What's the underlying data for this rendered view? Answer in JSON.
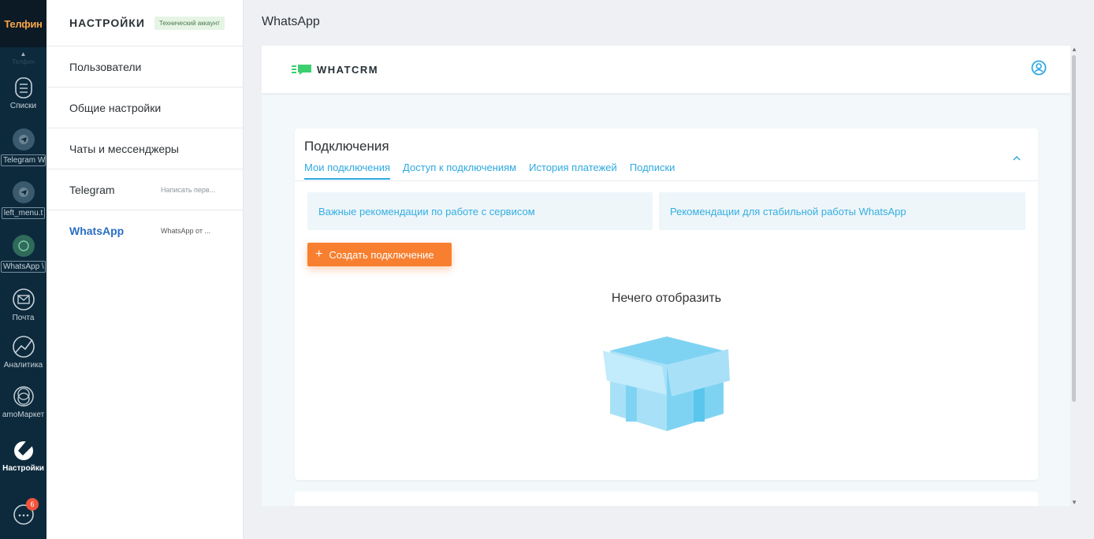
{
  "app": {
    "logo": "Телфин"
  },
  "left_nav": {
    "scroll_hint": "Телфин",
    "items": [
      {
        "label": "Списки",
        "icon": "list-icon"
      },
      {
        "label": "Telegram W",
        "icon": "telegram-icon"
      },
      {
        "label": "left_menu.t",
        "icon": "telegram-icon"
      },
      {
        "label": "WhatsApp \\",
        "icon": "whatsapp-icon"
      },
      {
        "label": "Почта",
        "icon": "mail-icon"
      },
      {
        "label": "Аналитика",
        "icon": "analytics-icon"
      },
      {
        "label": "amoМаркет",
        "icon": "market-icon"
      },
      {
        "label": "Настройки",
        "icon": "settings-icon"
      }
    ],
    "chat_badge": "6"
  },
  "settings": {
    "title": "НАСТРОЙКИ",
    "account_badge": "Технический аккаунт",
    "items": [
      {
        "label": "Пользователи"
      },
      {
        "label": "Общие настройки"
      },
      {
        "label": "Чаты и мессенджеры"
      },
      {
        "label": "Telegram",
        "sub": "Написать перв..."
      },
      {
        "label": "WhatsApp",
        "sub": "WhatsApp от ..."
      }
    ]
  },
  "main": {
    "page_title": "WhatsApp",
    "brand": "WHATCRM",
    "card": {
      "title": "Подключения",
      "tabs": [
        "Мои подключения",
        "Доступ к подключениям",
        "История платежей",
        "Подписки"
      ],
      "active_tab": 0,
      "recommendations": [
        "Важные рекомендации по работе с сервисом",
        "Рекомендации для стабильной работы WhatsApp"
      ],
      "create_button": "Создать подключение",
      "empty_text": "Нечего отобразить"
    }
  },
  "colors": {
    "accent": "#2fa9e0",
    "orange": "#f77f2f",
    "sidebar": "#0d2a3d",
    "active_link": "#2a6ec4"
  }
}
